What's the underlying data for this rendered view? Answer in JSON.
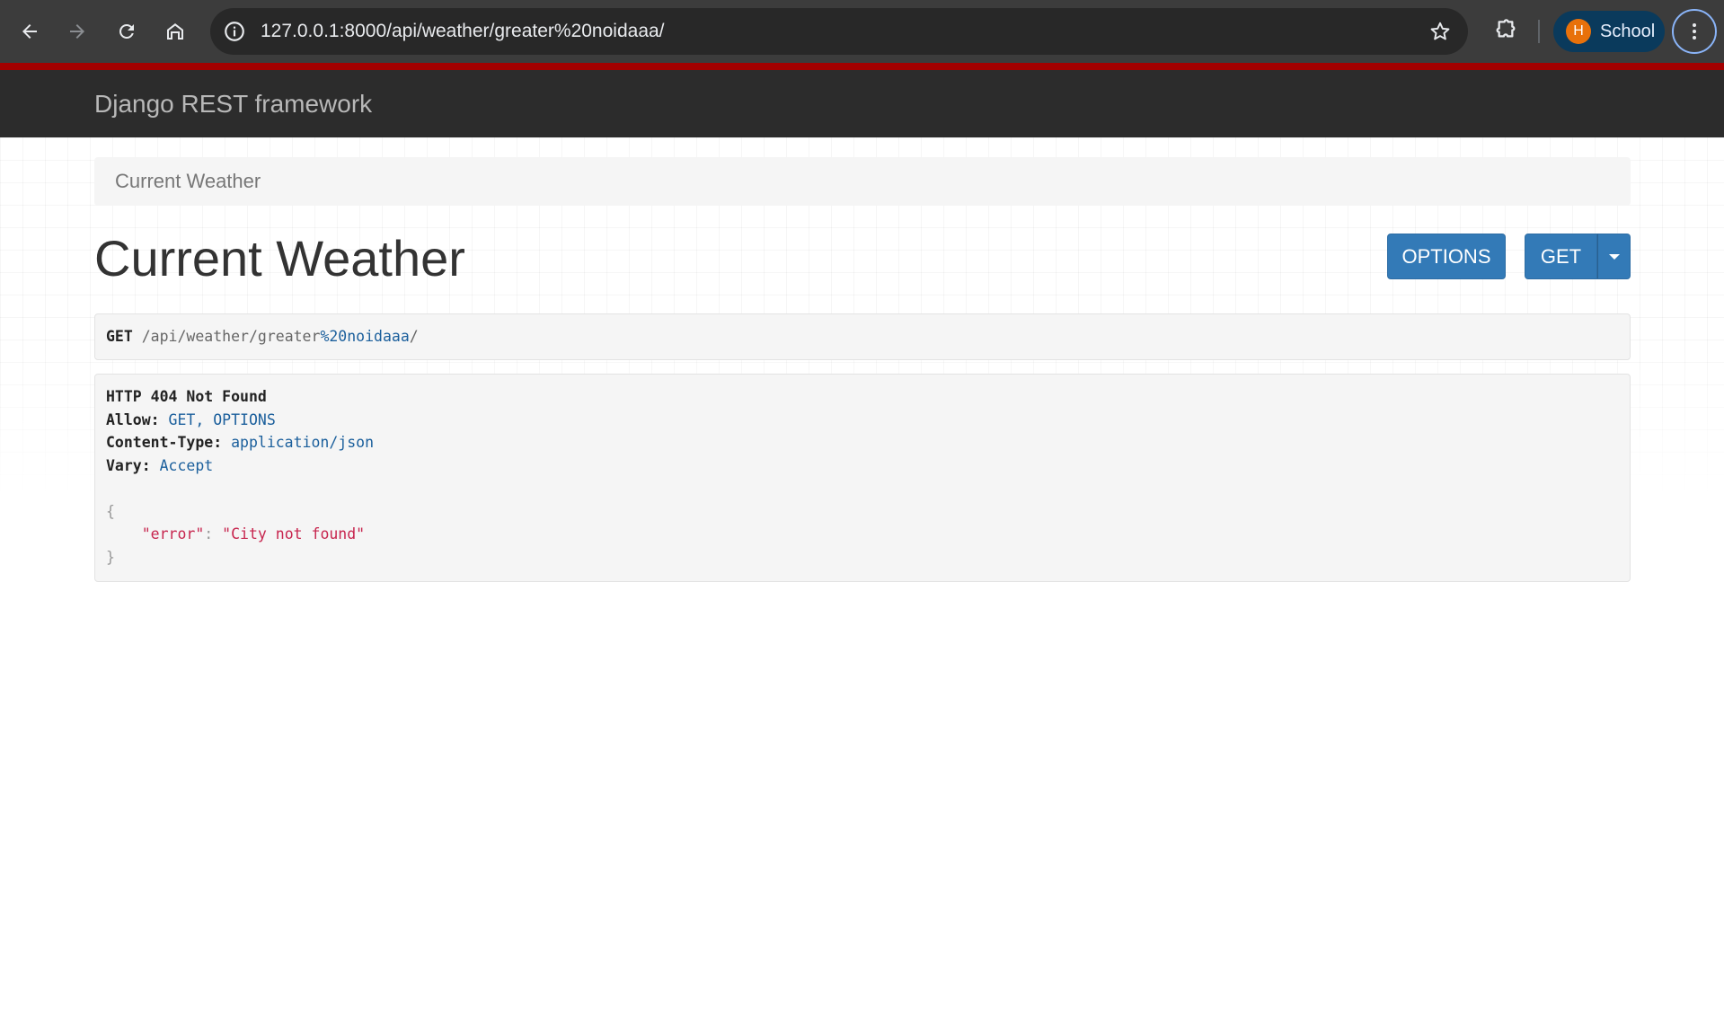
{
  "browser": {
    "url": "127.0.0.1:8000/api/weather/greater%20noidaaa/",
    "profile_initial": "H",
    "profile_name": "School"
  },
  "navbar": {
    "brand": "Django REST framework"
  },
  "breadcrumb": {
    "current": "Current Weather"
  },
  "page": {
    "title": "Current Weather",
    "options_label": "OPTIONS",
    "get_label": "GET"
  },
  "request": {
    "method": "GET",
    "path_prefix": "/api/weather/greater",
    "path_encoded": "%20noidaaa",
    "path_suffix": "/"
  },
  "response": {
    "status": "HTTP 404 Not Found",
    "headers": [
      {
        "key": "Allow:",
        "value": "GET, OPTIONS"
      },
      {
        "key": "Content-Type:",
        "value": "application/json"
      },
      {
        "key": "Vary:",
        "value": "Accept"
      }
    ],
    "open_brace": "{",
    "body_key": "\"error\"",
    "body_colon": ":",
    "body_value": "\"City not found\"",
    "close_brace": "}"
  }
}
